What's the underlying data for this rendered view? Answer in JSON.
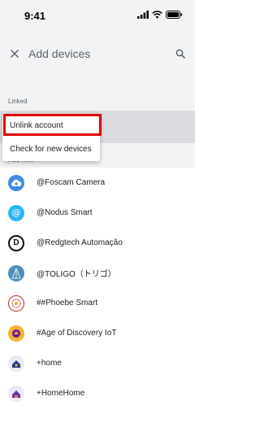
{
  "status": {
    "time": "9:41"
  },
  "header": {
    "title": "Add devices"
  },
  "sections": {
    "linked": "Linked",
    "add_new": "Add new"
  },
  "menu": {
    "unlink": "Unlink account",
    "check": "Check for new devices"
  },
  "devices": [
    {
      "name": "@Foscam Camera",
      "icon": "cloud-camera-icon",
      "color": "#3d8ae0"
    },
    {
      "name": "@Nodus Smart",
      "icon": "at-sign-icon",
      "color": "#29b6f6"
    },
    {
      "name": "@Redgtech Automação",
      "icon": "redgtech-logo-icon",
      "color": "#111111"
    },
    {
      "name": "@TOLIGO（トリゴ）",
      "icon": "toligo-logo-icon",
      "color": "#4f8fb8"
    },
    {
      "name": "##Phoebe Smart",
      "icon": "phoebe-logo-icon",
      "color": "#c62828"
    },
    {
      "name": "#Age of Discovery IoT",
      "icon": "age-of-discovery-logo-icon",
      "color": "#f2b233"
    },
    {
      "name": "+home",
      "icon": "home-logo-icon",
      "color": "#1a3a8c"
    },
    {
      "name": "+HomeHome",
      "icon": "homehome-logo-icon",
      "color": "#3f51b5"
    }
  ]
}
